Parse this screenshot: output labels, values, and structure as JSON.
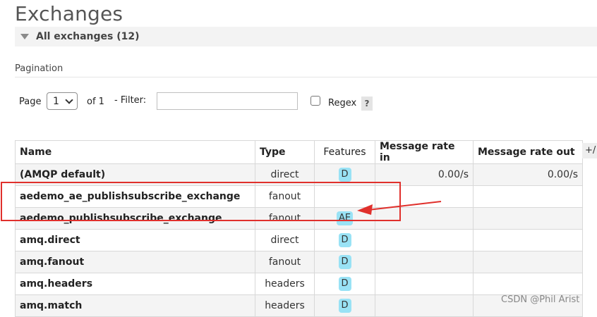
{
  "page_title": "Exchanges",
  "section": {
    "label": "All exchanges (12)"
  },
  "pagination": {
    "title": "Pagination",
    "page_label": "Page",
    "page_value": "1",
    "of_label": "of 1",
    "filter_label": "- Filter:",
    "filter_value": "",
    "regex_label": "Regex",
    "regex_checked": false,
    "help_label": "?"
  },
  "table": {
    "columns": [
      "Name",
      "Type",
      "Features",
      "Message rate in",
      "Message rate out"
    ],
    "add_column_label": "+/",
    "rows": [
      {
        "name": "(AMQP default)",
        "type": "direct",
        "features": "D",
        "rate_in": "0.00/s",
        "rate_out": "0.00/s"
      },
      {
        "name": "aedemo_ae_publishsubscribe_exchange",
        "type": "fanout",
        "features": "",
        "rate_in": "",
        "rate_out": ""
      },
      {
        "name": "aedemo_publishsubscribe_exchange",
        "type": "fanout",
        "features": "AE",
        "rate_in": "",
        "rate_out": ""
      },
      {
        "name": "amq.direct",
        "type": "direct",
        "features": "D",
        "rate_in": "",
        "rate_out": ""
      },
      {
        "name": "amq.fanout",
        "type": "fanout",
        "features": "D",
        "rate_in": "",
        "rate_out": ""
      },
      {
        "name": "amq.headers",
        "type": "headers",
        "features": "D",
        "rate_in": "",
        "rate_out": ""
      },
      {
        "name": "amq.match",
        "type": "headers",
        "features": "D",
        "rate_in": "",
        "rate_out": ""
      }
    ]
  },
  "annotation_color": "#e0302c",
  "badge_color": "#99e2f5",
  "watermark": "CSDN @Phil Arist"
}
